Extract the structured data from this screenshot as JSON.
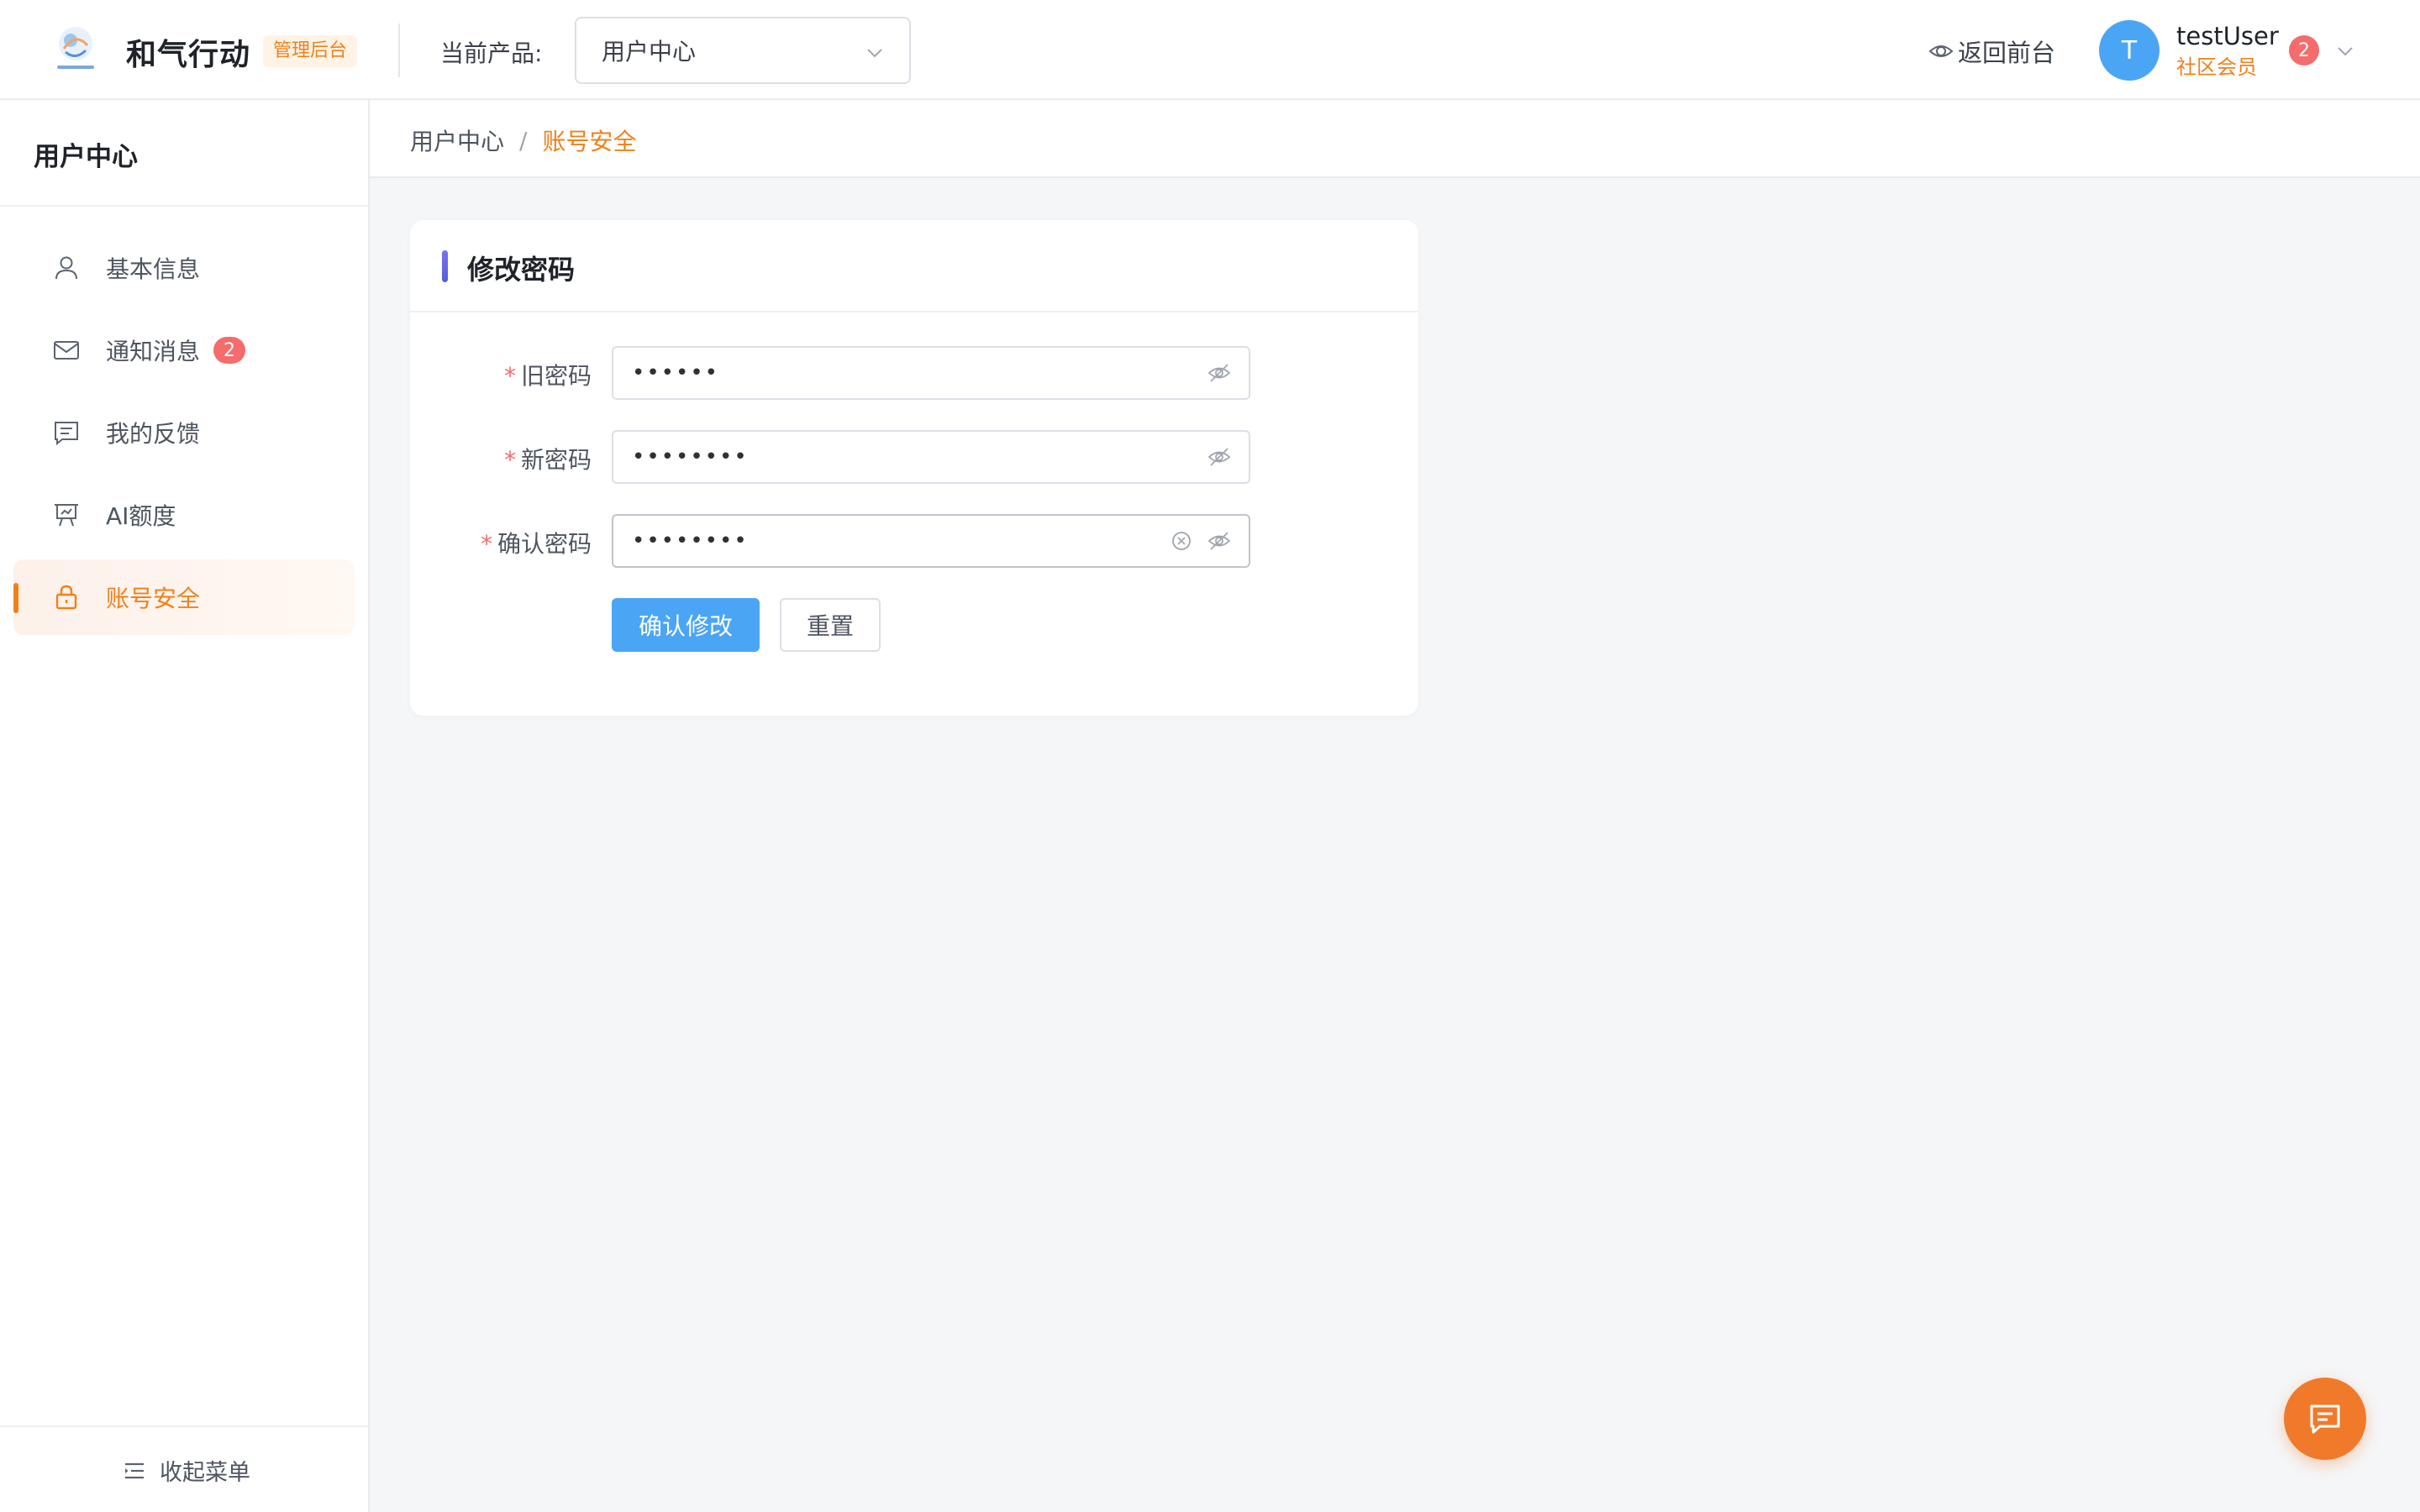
{
  "header": {
    "app_title": "和气行动",
    "admin_tag": "管理后台",
    "product_label": "当前产品:",
    "product_selected": "用户中心",
    "back_front": "返回前台",
    "user": {
      "avatar_letter": "T",
      "name": "testUser",
      "role": "社区会员",
      "badge": "2"
    }
  },
  "sidebar": {
    "title": "用户中心",
    "items": [
      {
        "label": "基本信息",
        "icon": "user-icon"
      },
      {
        "label": "通知消息",
        "icon": "mail-icon",
        "badge": "2"
      },
      {
        "label": "我的反馈",
        "icon": "message-icon"
      },
      {
        "label": "AI额度",
        "icon": "presentation-icon"
      },
      {
        "label": "账号安全",
        "icon": "lock-icon",
        "active": true
      }
    ],
    "collapse_label": "收起菜单"
  },
  "breadcrumb": {
    "parent": "用户中心",
    "separator": "/",
    "current": "账号安全"
  },
  "card": {
    "title": "修改密码",
    "fields": [
      {
        "label": "旧密码",
        "value": "••••••"
      },
      {
        "label": "新密码",
        "value": "••••••••"
      },
      {
        "label": "确认密码",
        "value": "••••••••"
      }
    ],
    "required_mark": "*",
    "submit_label": "确认修改",
    "reset_label": "重置"
  },
  "colors": {
    "accent": "#f0801a",
    "primary": "#4ba5f5",
    "danger": "#f56c6c"
  }
}
